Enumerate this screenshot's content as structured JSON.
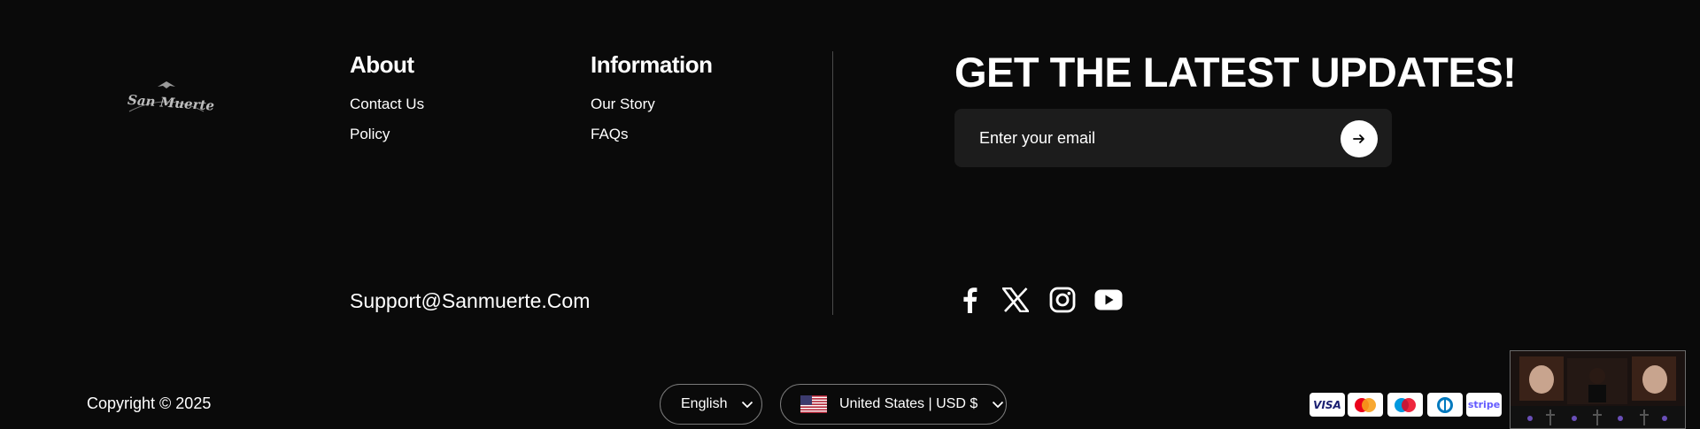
{
  "brand": {
    "logo_text": "San Muerte"
  },
  "about": {
    "title": "About",
    "links": [
      "Contact Us",
      "Policy"
    ]
  },
  "information": {
    "title": "Information",
    "links": [
      "Our Story",
      "FAQs"
    ]
  },
  "support_email": "Support@Sanmuerte.Com",
  "newsletter": {
    "headline": "GET THE LATEST UPDATES!",
    "placeholder": "Enter your email"
  },
  "social": [
    "facebook-icon",
    "x-icon",
    "instagram-icon",
    "youtube-icon"
  ],
  "copyright": "Copyright © 2025",
  "language": {
    "selected": "English"
  },
  "currency": {
    "selected": "United States | USD $"
  },
  "payments": {
    "visa": "VISA",
    "stripe": "stripe",
    "icons": [
      "visa-icon",
      "mastercard-icon",
      "maestro-icon",
      "diners-club-icon",
      "stripe-icon"
    ]
  },
  "colors": {
    "background": "#0a0a0a",
    "input_bg": "#1c1c1c",
    "divider": "#4a4a4a",
    "stripe": "#635bff"
  }
}
